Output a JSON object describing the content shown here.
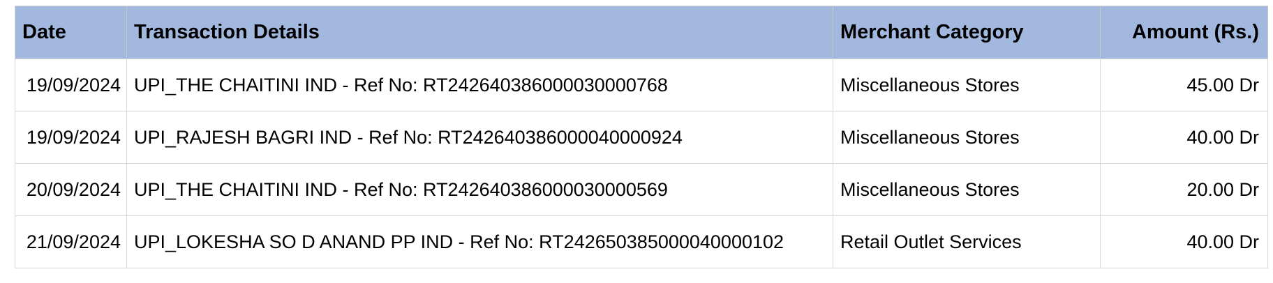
{
  "table": {
    "headers": {
      "date": "Date",
      "details": "Transaction Details",
      "merchant": "Merchant Category",
      "amount": "Amount (Rs.)"
    },
    "rows": [
      {
        "date": "19/09/2024",
        "details": "UPI_THE CHAITINI IND - Ref No: RT242640386000030000768",
        "merchant": "Miscellaneous Stores",
        "amount": "45.00 Dr"
      },
      {
        "date": "19/09/2024",
        "details": "UPI_RAJESH BAGRI IND - Ref No: RT242640386000040000924",
        "merchant": "Miscellaneous Stores",
        "amount": "40.00 Dr"
      },
      {
        "date": "20/09/2024",
        "details": "UPI_THE CHAITINI IND - Ref No: RT242640386000030000569",
        "merchant": "Miscellaneous Stores",
        "amount": "20.00 Dr"
      },
      {
        "date": "21/09/2024",
        "details": "UPI_LOKESHA SO D ANAND PP IND - Ref No: RT242650385000040000102",
        "merchant": "Retail Outlet Services",
        "amount": "40.00 Dr"
      }
    ]
  },
  "colors": {
    "header_background": "#a3b8de",
    "grid_line": "#d9d9d9"
  }
}
